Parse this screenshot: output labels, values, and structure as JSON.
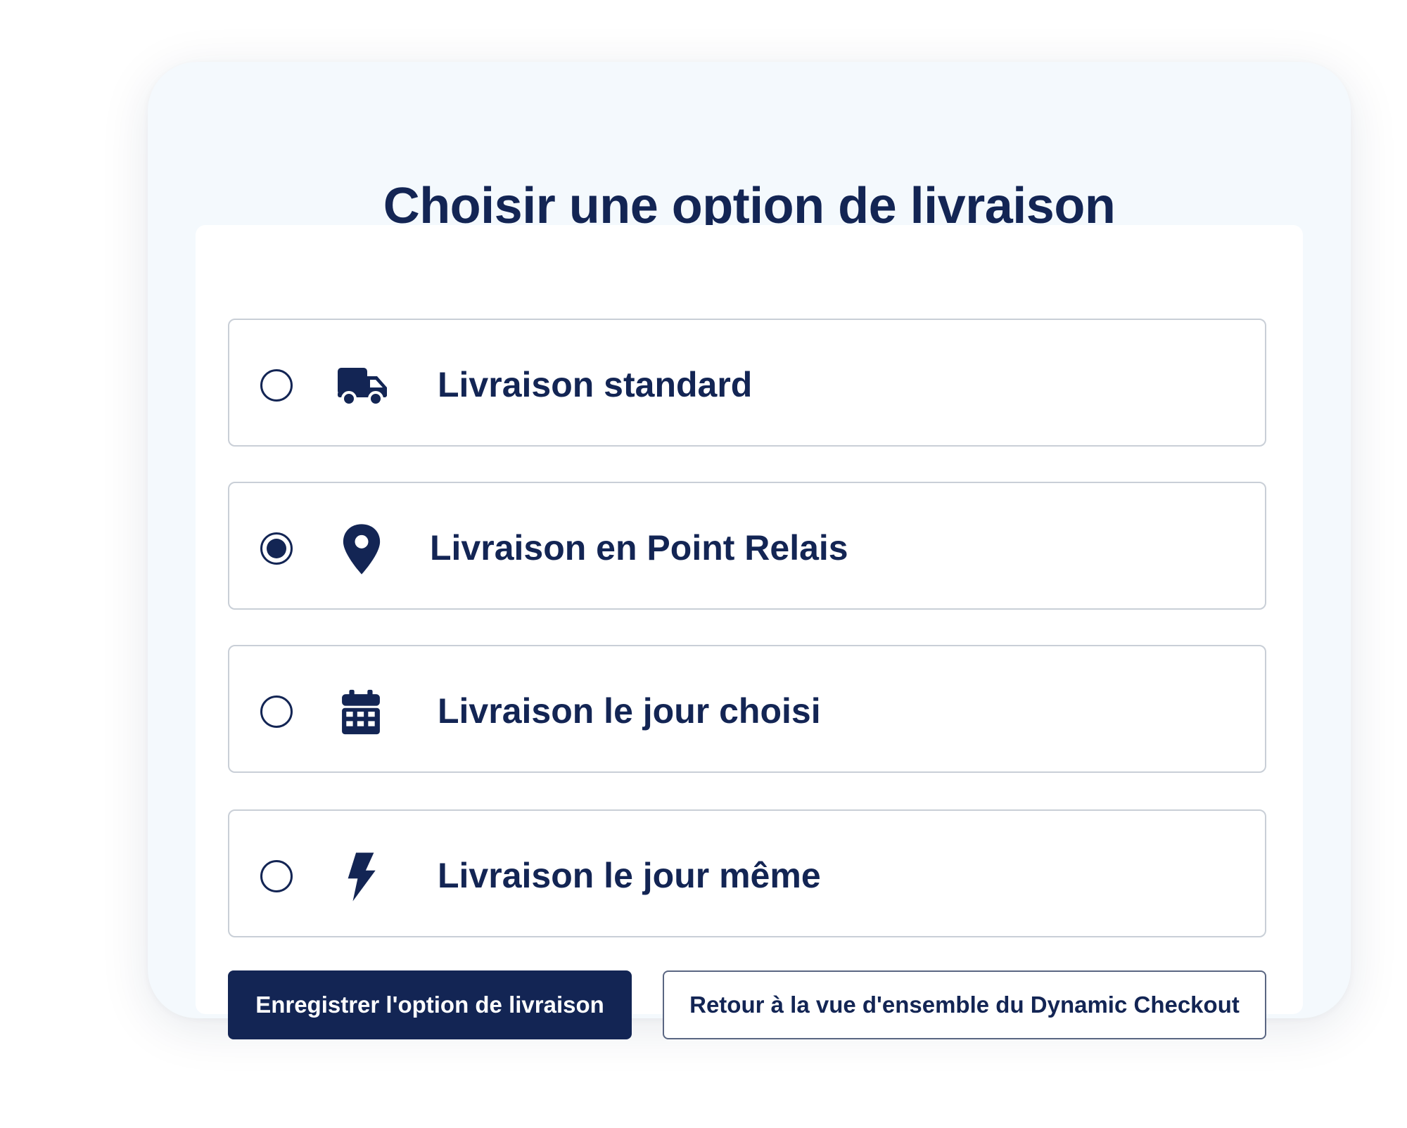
{
  "dialog": {
    "title": "Choisir une option de livraison"
  },
  "options": [
    {
      "label": "Livraison standard",
      "icon": "truck-icon",
      "selected": false
    },
    {
      "label": "Livraison en Point Relais",
      "icon": "map-pin-icon",
      "selected": true
    },
    {
      "label": "Livraison le jour choisi",
      "icon": "calendar-icon",
      "selected": false
    },
    {
      "label": "Livraison le jour même",
      "icon": "lightning-bolt-icon",
      "selected": false
    }
  ],
  "actions": {
    "save_label": "Enregistrer l'option de livraison",
    "back_label": "Retour à la vue d'ensemble du Dynamic Checkout"
  },
  "colors": {
    "primary": "#132554",
    "card_background": "#f4f9fd",
    "border": "#c9cfd7"
  }
}
